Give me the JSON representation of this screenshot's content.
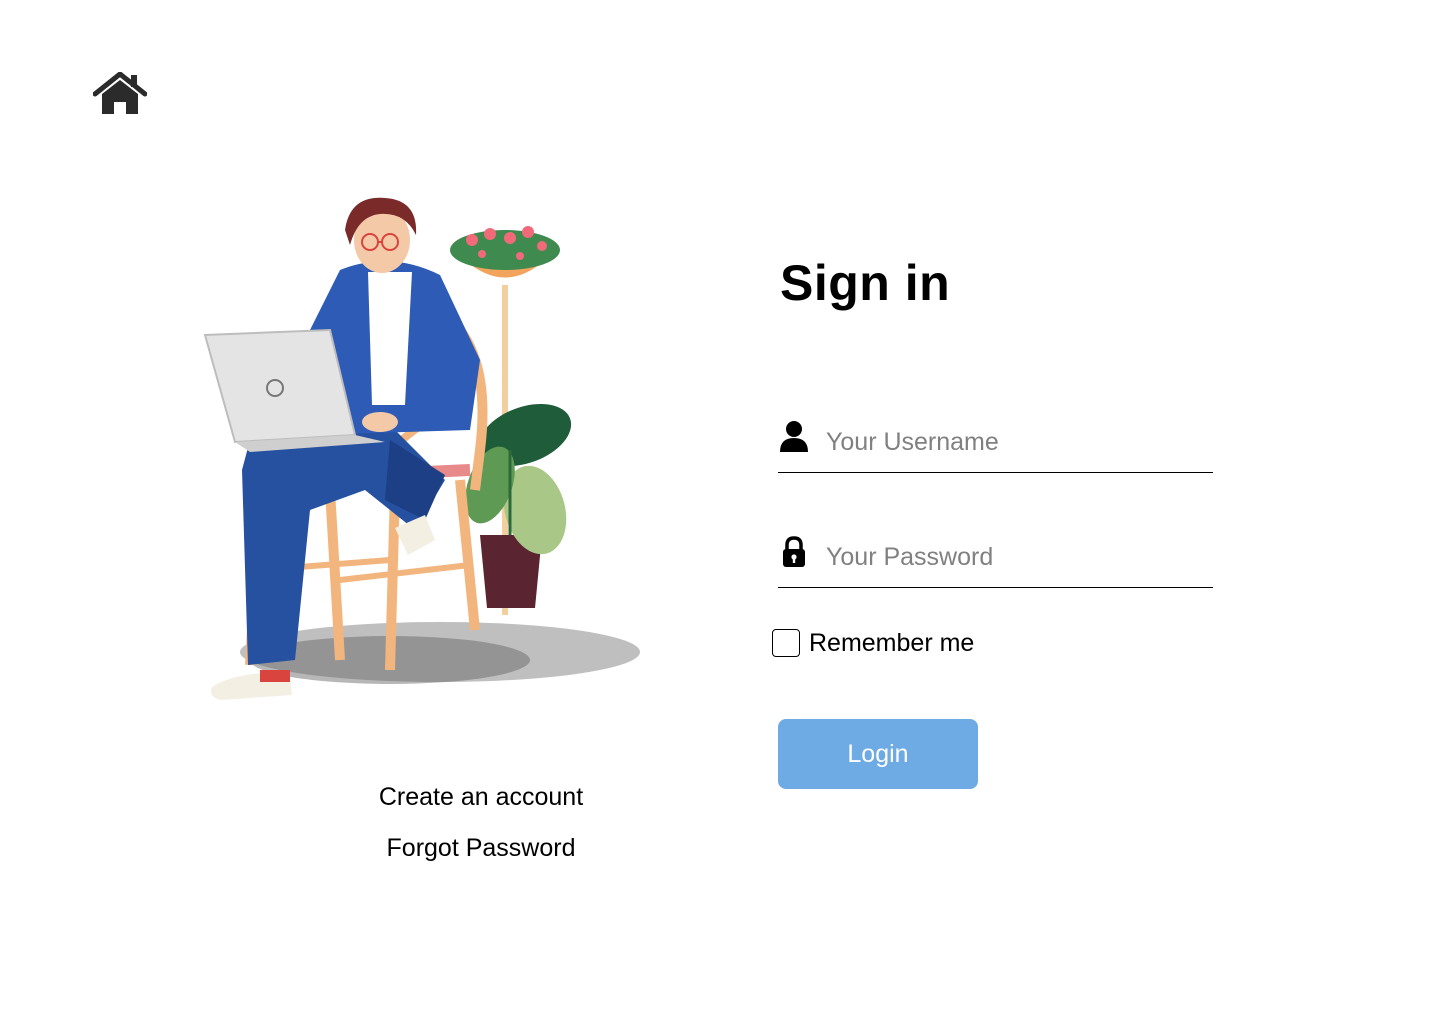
{
  "nav": {
    "home_icon": "home-icon"
  },
  "illustration": {
    "subject": "person-with-laptop-on-chair-illustration"
  },
  "links": {
    "create_account": "Create an account",
    "forgot_password": "Forgot Password"
  },
  "form": {
    "title": "Sign in",
    "username": {
      "icon": "user-icon",
      "placeholder": "Your Username",
      "value": ""
    },
    "password": {
      "icon": "lock-icon",
      "placeholder": "Your Password",
      "value": ""
    },
    "remember": {
      "label": "Remember me",
      "checked": false
    },
    "login_label": "Login"
  },
  "colors": {
    "login_button": "#6eaae3",
    "placeholder_text": "#808080",
    "text": "#000000"
  }
}
